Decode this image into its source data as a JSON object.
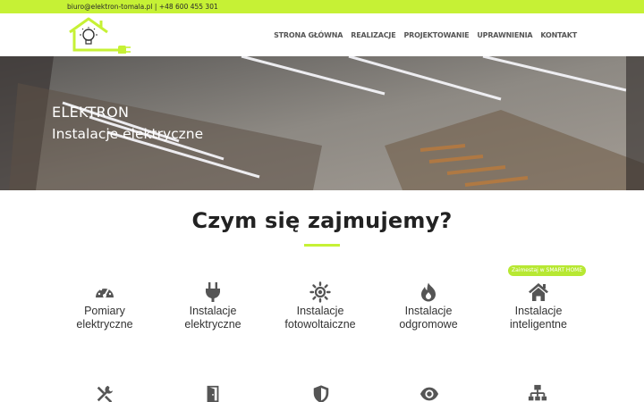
{
  "topbar": {
    "email": "biuro@elektron-tomala.pl",
    "separator": " | ",
    "phone": "+48 600 455 301"
  },
  "brand": {
    "accent": "#c6f135",
    "text": "#333333"
  },
  "nav": {
    "items": [
      "STRONA GŁÓWNA",
      "REALIZACJE",
      "PROJEKTOWANIE",
      "UPRAWNIENIA",
      "KONTAKT"
    ]
  },
  "hero": {
    "title": "ELEKTRON",
    "subtitle": "Instalacje elektryczne"
  },
  "services": {
    "heading": "Czym się zajmujemy?",
    "badge": "Zaimestaj w SMART HOME",
    "items": [
      {
        "line1": "Pomiary",
        "line2": "elektryczne",
        "icon": "gauge-icon"
      },
      {
        "line1": "Instalacje",
        "line2": "elektryczne",
        "icon": "plug-icon"
      },
      {
        "line1": "Instalacje",
        "line2": "fotowoltaiczne",
        "icon": "sun-icon"
      },
      {
        "line1": "Instalacje",
        "line2": "odgromowe",
        "icon": "flame-icon"
      },
      {
        "line1": "Instalacje",
        "line2": "inteligentne",
        "icon": "home-icon"
      }
    ],
    "row2_icons": [
      "tools-icon",
      "door-icon",
      "shield-icon",
      "eye-icon",
      "network-icon"
    ]
  }
}
